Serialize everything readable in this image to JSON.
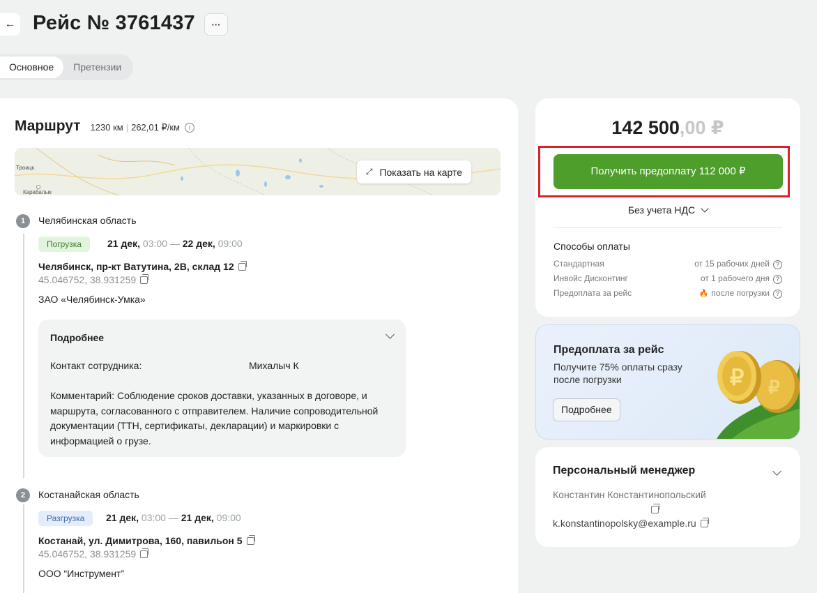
{
  "header": {
    "back_icon": "arrow-left-icon",
    "title": "Рейс № 3761437",
    "more_label": "···"
  },
  "tabs": [
    {
      "label": "Основное",
      "active": true
    },
    {
      "label": "Претензии",
      "active": false
    }
  ],
  "route": {
    "title": "Маршрут",
    "distance": "1230 км",
    "rate": "262,01 ₽/км",
    "map": {
      "button_label": "Показать на карте",
      "labels": {
        "city1": "Троицк",
        "city2": "Карабалык"
      }
    },
    "stops": [
      {
        "number": "1",
        "region": "Челябинская область",
        "tag": "Погрузка",
        "date_from": "21 дек,",
        "time_from": "03:00",
        "dash": "—",
        "date_to": "22 дек,",
        "time_to": "09:00",
        "address": "Челябинск, пр-кт Ватутина, 2В, склад 12",
        "coords": "45.046752, 38.931259",
        "company": "ЗАО «Челябинск-Умка»",
        "details": {
          "title": "Подробнее",
          "contact_label": "Контакт сотрудника:",
          "contact_value": "Михалыч К",
          "comment": "Комментарий: Соблюдение сроков доставки, указанных в договоре, и маршрута, согласованного с отправителем. Наличие сопроводительной документации (ТТН, сертификаты, декларации) и маркировки с информацией о грузе."
        }
      },
      {
        "number": "2",
        "region": "Костанайская область",
        "tag": "Разгрузка",
        "date_from": "21 дек,",
        "time_from": "03:00",
        "dash": "—",
        "date_to": "21 дек,",
        "time_to": "09:00",
        "address": "Костанай, ул. Димитрова, 160, павильон 5",
        "coords": "45.046752, 38.931259",
        "company": "ООО “Инструмент”"
      }
    ]
  },
  "price": {
    "main": "142 500",
    "kopecks": ",00 ₽",
    "prepay_button": "Получить предоплату 112 000 ₽",
    "vat_label": "Без учета НДС",
    "methods_title": "Способы оплаты",
    "methods": [
      {
        "name": "Стандартная",
        "term": "от 15 рабочих дней",
        "fire": false
      },
      {
        "name": "Инвойс Дисконтинг",
        "term": "от 1 рабочего дня",
        "fire": false
      },
      {
        "name": "Предоплата за рейс",
        "term": "после погрузки",
        "fire": true
      }
    ]
  },
  "promo": {
    "title": "Предоплата за рейс",
    "text": "Получите 75% оплаты сразу после погрузки",
    "button": "Подробнее"
  },
  "manager": {
    "title": "Персональный менеджер",
    "name": "Константин Константинопольский",
    "email": "k.konstantinopolsky@example.ru"
  },
  "colors": {
    "accent_green": "#4d9e2a",
    "highlight_red": "#d8232a",
    "load_tag_bg": "#e3f4de",
    "unload_tag_bg": "#e3edfb"
  }
}
